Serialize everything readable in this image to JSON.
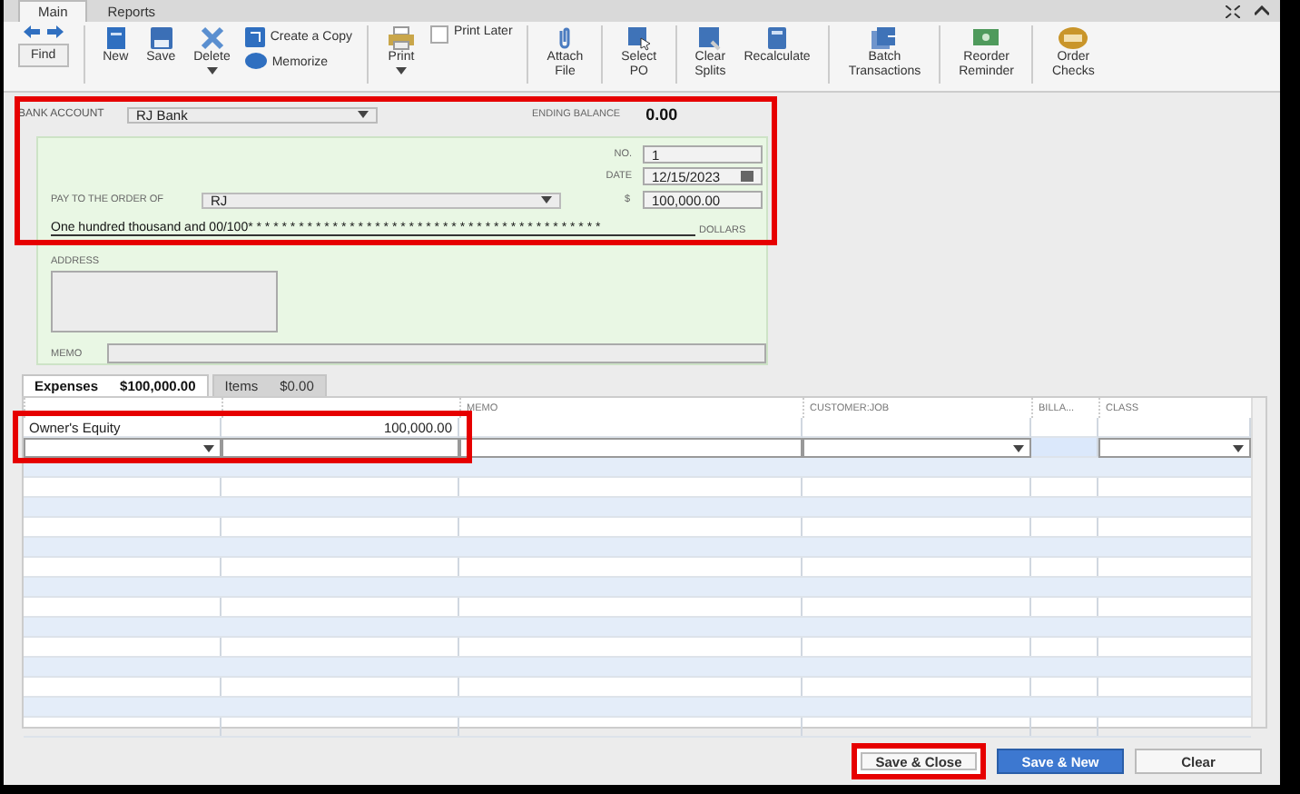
{
  "tabs": [
    {
      "label": "Main",
      "selected": true
    },
    {
      "label": "Reports",
      "selected": false
    }
  ],
  "toolbar_groups": [
    [
      {
        "kind": "find",
        "label": "Find"
      }
    ],
    [
      {
        "kind": "new",
        "label": "New"
      },
      {
        "kind": "save",
        "label": "Save"
      },
      {
        "kind": "delete",
        "label": "Delete",
        "dropdown": true
      },
      {
        "kind": "stack",
        "items": [
          {
            "kind": "copy",
            "label": "Create a Copy"
          },
          {
            "kind": "memorize",
            "label": "Memorize"
          }
        ]
      }
    ],
    [
      {
        "kind": "print",
        "label": "Print",
        "dropdown": true
      },
      {
        "kind": "checkbox",
        "label": "Print Later",
        "checked": false
      }
    ],
    [
      {
        "kind": "attach",
        "label": "Attach\nFile"
      }
    ],
    [
      {
        "kind": "select",
        "label": "Select\nPO"
      }
    ],
    [
      {
        "kind": "clear",
        "label": "Clear\nSplits"
      },
      {
        "kind": "recalc",
        "label": "Recalculate"
      }
    ],
    [
      {
        "kind": "batch",
        "label": "Batch\nTransactions"
      }
    ],
    [
      {
        "kind": "reorder",
        "label": "Reorder\nReminder"
      }
    ],
    [
      {
        "kind": "order",
        "label": "Order\nChecks"
      }
    ]
  ],
  "header": {
    "highlighted": true,
    "bank_account": {
      "label": "BANK ACCOUNT",
      "value": "RJ Bank"
    },
    "ending_balance": {
      "label": "ENDING BALANCE",
      "value": "0.00"
    }
  },
  "check": {
    "number": {
      "label": "NO.",
      "value": "1"
    },
    "date": {
      "label": "DATE",
      "value": "12/15/2023"
    },
    "payee": {
      "label": "PAY TO THE ORDER OF",
      "value": "RJ"
    },
    "amount": {
      "label": "$",
      "value": "100,000.00"
    },
    "amount_words": "One hundred thousand  and 00/100* * * * * * * * * * * * * * * * * * * * * * * * * * * * * * * * * * * * * * * * * *",
    "dollars_label": "DOLLARS",
    "address": {
      "label": "ADDRESS"
    },
    "memo": {
      "label": "MEMO"
    }
  },
  "split_tabs": [
    {
      "label": "Expenses",
      "amount": "$100,000.00",
      "selected": true
    },
    {
      "label": "Items",
      "amount": "$0.00",
      "selected": false
    }
  ],
  "grid": {
    "columns": [
      "MEMO",
      "CUSTOMER:JOB",
      "BILLA...",
      "CLASS"
    ],
    "rows": [
      {
        "cells": [
          "Owner's Equity",
          "100,000.00"
        ],
        "highlighted": true
      }
    ]
  },
  "buttons": [
    {
      "label": "Save & Close",
      "kind": "default",
      "highlighted": true
    },
    {
      "label": "Save & New",
      "kind": "primary",
      "highlighted": false
    },
    {
      "label": "Clear",
      "kind": "default",
      "highlighted": false
    }
  ]
}
